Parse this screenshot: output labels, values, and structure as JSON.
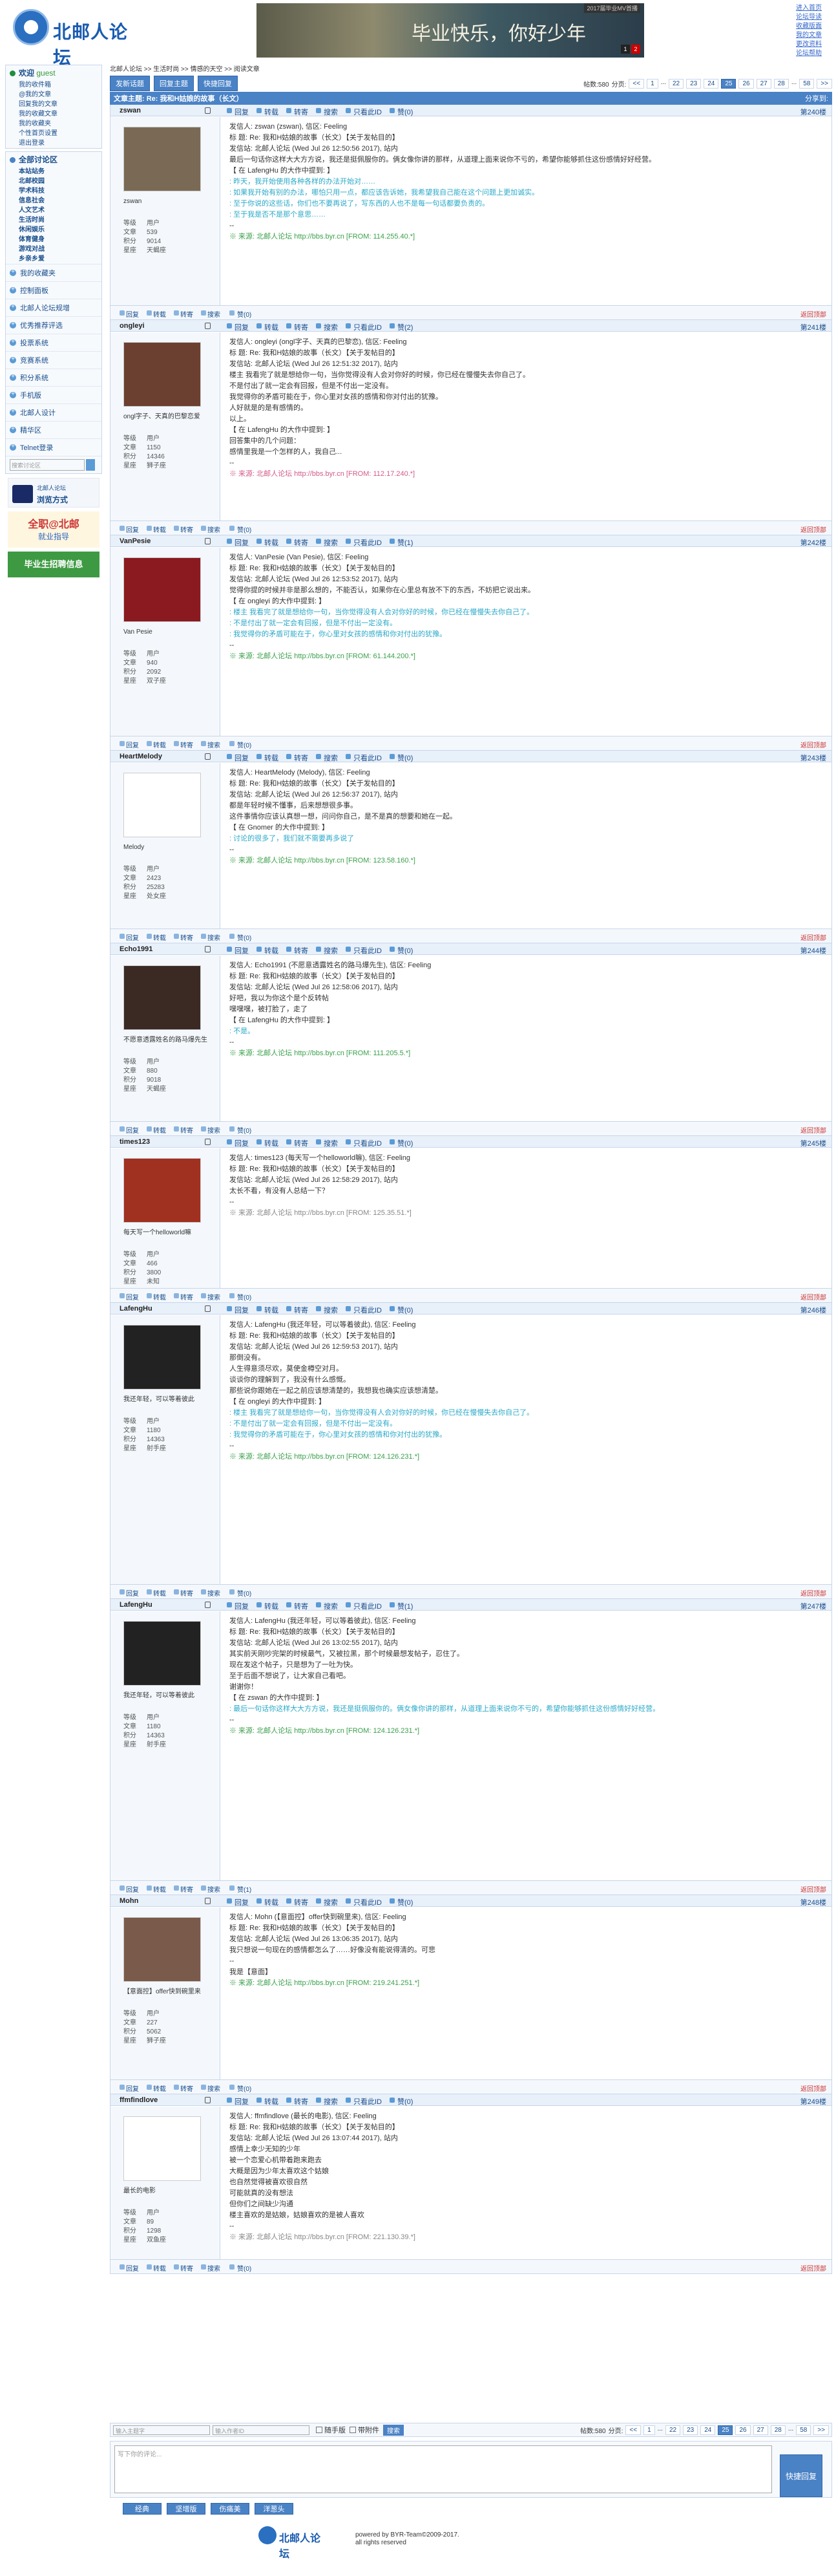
{
  "header": {
    "logo_text": "北邮人论坛",
    "banner_caption": "2017届毕业MV首播",
    "banner_title": "毕业快乐，你好少年",
    "banner_pages": [
      "1",
      "2"
    ],
    "top_links": [
      "进入首页",
      "论坛导读",
      "收藏版面",
      "我的文章",
      "更改资料",
      "论坛帮助"
    ]
  },
  "sidebar": {
    "welcome": "欢迎",
    "guest": "guest",
    "user_links": [
      "我的收件箱",
      "@我的文章",
      "回复我的文章",
      "我的收藏文章",
      "我的收藏夹",
      "个性首页设置",
      "退出登录"
    ],
    "section_title": "全部讨论区",
    "sections": [
      "本站站务",
      "北邮校园",
      "学术科技",
      "信息社会",
      "人文艺术",
      "生活时尚",
      "休闲娱乐",
      "体育健身",
      "游戏对战",
      "乡亲乡爱"
    ],
    "items": [
      "我的收藏夹",
      "控制面板",
      "北邮人论坛规增",
      "优秀推荐评选",
      "投票系统",
      "竞赛系统",
      "积分系统",
      "手机版",
      "北邮人设计",
      "精华区",
      "Telnet登录"
    ],
    "search_placeholder": "搜索讨论区",
    "ads": {
      "a1_title": "北邮人论坛",
      "a1_text": "浏览方式",
      "a2_title": "全职@北邮",
      "a2_text": "就业指导",
      "a3_text": "毕业生招聘信息"
    }
  },
  "main": {
    "breadcrumb": "北邮人论坛 >> 生活时尚 >> 情感的天空 >> 阅读文章",
    "buttons": [
      "发新话题",
      "回复主题",
      "快捷回复"
    ],
    "post_count": "帖数:580",
    "pager_label": "分页:",
    "pages": [
      "<<",
      "1",
      "...",
      "22",
      "23",
      "24",
      "25",
      "26",
      "27",
      "28",
      "...",
      "58",
      ">>"
    ],
    "current_page": "25",
    "topic_prefix": "文章主题:",
    "topic": "Re: 我和H姑娘的故事（长文）",
    "share": "分享到:",
    "post_actions": [
      "回复",
      "转载",
      "转寄",
      "搜索",
      "只看此ID"
    ],
    "foot_actions": [
      "回复",
      "转载",
      "转寄",
      "搜索"
    ],
    "back_top": "返回顶部",
    "labels": {
      "role": "等级",
      "posts": "文章",
      "score": "积分",
      "star": "星座"
    }
  },
  "posts": [
    {
      "uid": "zswan",
      "floor": "第240楼",
      "praise": "赞(0)",
      "up": "赞(0)",
      "nick": "zswan",
      "role": "用户",
      "posts": "539",
      "score": "9014",
      "star": "天蝎座",
      "avatar_color": "#7a6a55",
      "lines": [
        {
          "c": "",
          "t": "发信人: zswan (zswan), 信区: Feeling"
        },
        {
          "c": "",
          "t": "标  题: Re: 我和H姑娘的故事（长文）【关于发帖目的】"
        },
        {
          "c": "",
          "t": "发信站: 北邮人论坛 (Wed Jul 26 12:50:56 2017), 站内"
        },
        {
          "c": "",
          "t": " "
        },
        {
          "c": "",
          "t": "最后一句话你这样大大方方说，我还是挺佩服你的。俩女像你讲的那样，从道理上面来说你不亏的，希望你能够抓住这份感情好好经营。"
        },
        {
          "c": "",
          "t": "【 在 LafengHu 的大作中提到: 】"
        },
        {
          "c": "q",
          "t": ": 昨天，我开始使用各种各样的办法开始对……"
        },
        {
          "c": "q",
          "t": ": 如果我开始有别的办法，哪怕只用一点，都应该告诉她，我希望我自己能在这个问题上更加诚实。"
        },
        {
          "c": "q",
          "t": ": 至于你说的这些话，你们也不要再说了，写东西的人也不是每一句话都要负责的。"
        },
        {
          "c": "q",
          "t": ": 至于我是否不是那个意思……"
        },
        {
          "c": "",
          "t": " "
        },
        {
          "c": "",
          "t": " "
        },
        {
          "c": "",
          "t": "--"
        },
        {
          "c": "",
          "t": " "
        },
        {
          "c": "g",
          "t": "※ 来源: 北邮人论坛 http://bbs.byr.cn [FROM: 114.255.40.*]"
        }
      ]
    },
    {
      "uid": "ongleyi",
      "floor": "第241楼",
      "praise": "赞(2)",
      "up": "赞(0)",
      "nick": "ongl字子、天真的巴黎恋爱",
      "role": "用户",
      "posts": "1150",
      "score": "14346",
      "star": "狮子座",
      "avatar_color": "#6b4030",
      "lines": [
        {
          "c": "",
          "t": "发信人: ongleyi (ongl字子、天真的巴黎恋), 信区: Feeling"
        },
        {
          "c": "",
          "t": "标  题: Re: 我和H姑娘的故事（长文）【关于发帖目的】"
        },
        {
          "c": "",
          "t": "发信站: 北邮人论坛 (Wed Jul 26 12:51:32 2017), 站内"
        },
        {
          "c": "",
          "t": " "
        },
        {
          "c": "",
          "t": "楼主 我看完了就是想给你一句，当你觉得没有人会对你好的时候，你已经在慢慢失去你自己了。"
        },
        {
          "c": "",
          "t": " "
        },
        {
          "c": "",
          "t": "不是付出了就一定会有回报，但是不付出一定没有。"
        },
        {
          "c": "",
          "t": " "
        },
        {
          "c": "",
          "t": "我觉得你的矛盾可能在于，你心里对女孩的感情和你对付出的犹豫。"
        },
        {
          "c": "",
          "t": "人好就是的是有感情的。"
        },
        {
          "c": "",
          "t": "以上。"
        },
        {
          "c": "",
          "t": "【 在 LafengHu 的大作中提到: 】"
        },
        {
          "c": "",
          "t": "回答集中的几个问题："
        },
        {
          "c": "",
          "t": " "
        },
        {
          "c": "",
          "t": "感情里我是一个怎样的人，我自己..."
        },
        {
          "c": "",
          "t": " "
        },
        {
          "c": "",
          "t": "--"
        },
        {
          "c": "",
          "t": " "
        },
        {
          "c": "m",
          "t": "※ 来源: 北邮人论坛 http://bbs.byr.cn [FROM: 112.17.240.*]"
        }
      ]
    },
    {
      "uid": "VanPesie",
      "floor": "第242楼",
      "praise": "赞(1)",
      "up": "赞(0)",
      "nick": "Van Pesie",
      "role": "用户",
      "posts": "940",
      "score": "2092",
      "star": "双子座",
      "avatar_color": "#8a1a20",
      "lines": [
        {
          "c": "",
          "t": "发信人: VanPesie (Van Pesie), 信区: Feeling"
        },
        {
          "c": "",
          "t": "标  题: Re: 我和H姑娘的故事（长文）【关于发帖目的】"
        },
        {
          "c": "",
          "t": "发信站: 北邮人论坛 (Wed Jul 26 12:53:52 2017), 站内"
        },
        {
          "c": "",
          "t": " "
        },
        {
          "c": "",
          "t": "觉得你提的时候并非是那么想的，不能否认，如果你在心里总有放不下的东西，不妨把它说出来。"
        },
        {
          "c": "",
          "t": "【 在 ongleyi 的大作中提到: 】"
        },
        {
          "c": "q",
          "t": ": 楼主 我看完了就是想给你一句，当你觉得没有人会对你好的时候，你已经在慢慢失去你自己了。"
        },
        {
          "c": "q",
          "t": ": 不是付出了就一定会有回报，但是不付出一定没有。"
        },
        {
          "c": "q",
          "t": ": 我觉得你的矛盾可能在于，你心里对女孩的感情和你对付出的犹豫。"
        },
        {
          "c": "",
          "t": " "
        },
        {
          "c": "",
          "t": " "
        },
        {
          "c": "",
          "t": "--"
        },
        {
          "c": "",
          "t": " "
        },
        {
          "c": "g",
          "t": "※ 来源: 北邮人论坛 http://bbs.byr.cn [FROM: 61.144.200.*]"
        }
      ]
    },
    {
      "uid": "HeartMelody",
      "floor": "第243楼",
      "praise": "赞(0)",
      "up": "赞(0)",
      "nick": "Melody",
      "role": "用户",
      "posts": "2423",
      "score": "25283",
      "star": "处女座",
      "avatar_color": "#ffffff",
      "lines": [
        {
          "c": "",
          "t": "发信人: HeartMelody (Melody), 信区: Feeling"
        },
        {
          "c": "",
          "t": "标  题: Re: 我和H姑娘的故事（长文）【关于发帖目的】"
        },
        {
          "c": "",
          "t": "发信站: 北邮人论坛 (Wed Jul 26 12:56:37 2017), 站内"
        },
        {
          "c": "",
          "t": " "
        },
        {
          "c": "",
          "t": "都是年轻时候不懂事，后来想想很多事。"
        },
        {
          "c": "",
          "t": "这件事情你应该认真想一想，问问你自己，是不是真的想要和她在一起。"
        },
        {
          "c": "",
          "t": "【 在 Gnomer 的大作中提到: 】"
        },
        {
          "c": "q",
          "t": ": 讨论的很多了，我们就不需要再多说了"
        },
        {
          "c": "",
          "t": " "
        },
        {
          "c": "",
          "t": "--"
        },
        {
          "c": "",
          "t": " "
        },
        {
          "c": "g",
          "t": "※ 来源: 北邮人论坛 http://bbs.byr.cn [FROM: 123.58.160.*]"
        }
      ]
    },
    {
      "uid": "Echo1991",
      "floor": "第244楼",
      "praise": "赞(0)",
      "up": "赞(0)",
      "nick": "不愿意透露姓名的路马爆先生",
      "role": "用户",
      "posts": "880",
      "score": "9018",
      "star": "天蝎座",
      "avatar_color": "#3b2a24",
      "lines": [
        {
          "c": "",
          "t": "发信人: Echo1991 (不愿意透露姓名的路马爆先生), 信区: Feeling"
        },
        {
          "c": "",
          "t": "标  题: Re: 我和H姑娘的故事（长文）【关于发帖目的】"
        },
        {
          "c": "",
          "t": "发信站: 北邮人论坛 (Wed Jul 26 12:58:06 2017), 站内"
        },
        {
          "c": "",
          "t": " "
        },
        {
          "c": "",
          "t": "好吧，我以为你这个是个反转帖"
        },
        {
          "c": "",
          "t": "嘿嘿嘿，被打脸了，走了"
        },
        {
          "c": "",
          "t": "【 在 LafengHu 的大作中提到: 】"
        },
        {
          "c": "q",
          "t": ": 不是。"
        },
        {
          "c": "",
          "t": " "
        },
        {
          "c": "",
          "t": " "
        },
        {
          "c": "",
          "t": "--"
        },
        {
          "c": "",
          "t": " "
        },
        {
          "c": "g",
          "t": "※ 来源: 北邮人论坛 http://bbs.byr.cn [FROM: 111.205.5.*]"
        }
      ]
    },
    {
      "uid": "times123",
      "floor": "第245楼",
      "praise": "赞(0)",
      "up": "赞(0)",
      "nick": "每天写一个helloworld嘛",
      "role": "用户",
      "posts": "466",
      "score": "3800",
      "star": "未知",
      "avatar_color": "#a03020",
      "lines": [
        {
          "c": "",
          "t": "发信人: times123 (每天写一个helloworld嘛), 信区: Feeling"
        },
        {
          "c": "",
          "t": "标  题: Re: 我和H姑娘的故事（长文）【关于发帖目的】"
        },
        {
          "c": "",
          "t": "发信站: 北邮人论坛 (Wed Jul 26 12:58:29 2017), 站内"
        },
        {
          "c": "",
          "t": " "
        },
        {
          "c": "",
          "t": "太长不看，有没有人总结一下？"
        },
        {
          "c": "",
          "t": " "
        },
        {
          "c": "",
          "t": "--"
        },
        {
          "c": "",
          "t": " "
        },
        {
          "c": "sg",
          "t": "※ 来源: 北邮人论坛 http://bbs.byr.cn [FROM: 125.35.51.*]"
        }
      ]
    },
    {
      "uid": "LafengHu",
      "floor": "第246楼",
      "praise": "赞(0)",
      "up": "赞(0)",
      "nick": "我还年轻，可以等着彼此",
      "role": "用户",
      "posts": "1180",
      "score": "14363",
      "star": "射手座",
      "avatar_color": "#222222",
      "lines": [
        {
          "c": "",
          "t": "发信人: LafengHu (我还年轻，可以等着彼此), 信区: Feeling"
        },
        {
          "c": "",
          "t": "标  题: Re: 我和H姑娘的故事（长文）【关于发帖目的】"
        },
        {
          "c": "",
          "t": "发信站: 北邮人论坛 (Wed Jul 26 12:59:53 2017), 站内"
        },
        {
          "c": "",
          "t": " "
        },
        {
          "c": "",
          "t": "那倒没有。"
        },
        {
          "c": "",
          "t": " "
        },
        {
          "c": "",
          "t": "人生得意须尽欢，莫使金樽空对月。"
        },
        {
          "c": "",
          "t": " "
        },
        {
          "c": "",
          "t": "谈谈你的理解到了，我没有什么感慨。"
        },
        {
          "c": "",
          "t": " "
        },
        {
          "c": "",
          "t": "那些说你跟她在一起之前应该想清楚的，我想我也确实应该想清楚。"
        },
        {
          "c": "",
          "t": " "
        },
        {
          "c": "",
          "t": "【 在 ongleyi 的大作中提到: 】"
        },
        {
          "c": "q",
          "t": ": 楼主 我看完了就是想给你一句，当你觉得没有人会对你好的时候，你已经在慢慢失去你自己了。"
        },
        {
          "c": "q",
          "t": ": 不是付出了就一定会有回报，但是不付出一定没有。"
        },
        {
          "c": "q",
          "t": ": 我觉得你的矛盾可能在于，你心里对女孩的感情和你对付出的犹豫。"
        },
        {
          "c": "",
          "t": " "
        },
        {
          "c": "",
          "t": "--"
        },
        {
          "c": "",
          "t": " "
        },
        {
          "c": "g",
          "t": "※ 来源: 北邮人论坛 http://bbs.byr.cn [FROM: 124.126.231.*]"
        }
      ]
    },
    {
      "uid": "LafengHu",
      "floor": "第247楼",
      "praise": "赞(1)",
      "up": "赞(1)",
      "nick": "我还年轻，可以等着彼此",
      "role": "用户",
      "posts": "1180",
      "score": "14363",
      "star": "射手座",
      "avatar_color": "#222222",
      "lines": [
        {
          "c": "",
          "t": "发信人: LafengHu (我还年轻，可以等着彼此), 信区: Feeling"
        },
        {
          "c": "",
          "t": "标  题: Re: 我和H姑娘的故事（长文）【关于发帖目的】"
        },
        {
          "c": "",
          "t": "发信站: 北邮人论坛 (Wed Jul 26 13:02:55 2017), 站内"
        },
        {
          "c": "",
          "t": " "
        },
        {
          "c": "",
          "t": "其实前天刚吵完架的时候最气，又被拉黑，那个时候最想发帖子，忍住了。"
        },
        {
          "c": "",
          "t": " "
        },
        {
          "c": "",
          "t": "现在发这个帖子，只是想为了一吐为快。"
        },
        {
          "c": "",
          "t": " "
        },
        {
          "c": "",
          "t": "至于后面不想说了，让大家自己看吧。"
        },
        {
          "c": "",
          "t": " "
        },
        {
          "c": "",
          "t": "谢谢你！"
        },
        {
          "c": "",
          "t": " "
        },
        {
          "c": "",
          "t": "【 在 zswan 的大作中提到: 】"
        },
        {
          "c": "q",
          "t": ": 最后一句话你这样大大方方说，我还是挺佩服你的。俩女像你讲的那样，从道理上面来说你不亏的，希望你能够抓住这份感情好好经营。"
        },
        {
          "c": "",
          "t": " "
        },
        {
          "c": "",
          "t": "--"
        },
        {
          "c": "",
          "t": " "
        },
        {
          "c": "g",
          "t": "※ 来源: 北邮人论坛 http://bbs.byr.cn [FROM: 124.126.231.*]"
        }
      ]
    },
    {
      "uid": "Mohn",
      "floor": "第248楼",
      "praise": "赞(0)",
      "up": "赞(0)",
      "nick": "【意面控】offer快到碗里来",
      "role": "用户",
      "posts": "227",
      "score": "5062",
      "star": "狮子座",
      "avatar_color": "#7a5a4a",
      "lines": [
        {
          "c": "",
          "t": "发信人: Mohn (【意面控】offer快到碗里来), 信区: Feeling"
        },
        {
          "c": "",
          "t": "标  题: Re: 我和H姑娘的故事（长文）【关于发帖目的】"
        },
        {
          "c": "",
          "t": "发信站: 北邮人论坛 (Wed Jul 26 13:06:35 2017), 站内"
        },
        {
          "c": "",
          "t": " "
        },
        {
          "c": "",
          "t": "我只想说一句现在的感情都怎么了……好像没有能说得清的。可悲"
        },
        {
          "c": "",
          "t": " "
        },
        {
          "c": "",
          "t": "--"
        },
        {
          "c": "",
          "t": "我是【意面】"
        },
        {
          "c": "",
          "t": " "
        },
        {
          "c": "g",
          "t": "※ 来源: 北邮人论坛 http://bbs.byr.cn [FROM: 219.241.251.*]"
        }
      ]
    },
    {
      "uid": "ffmfindlove",
      "floor": "第249楼",
      "praise": "赞(0)",
      "up": "赞(0)",
      "nick": "最长的电影",
      "role": "用户",
      "posts": "89",
      "score": "1298",
      "star": "双鱼座",
      "avatar_color": "#ffffff",
      "lines": [
        {
          "c": "",
          "t": "发信人: ffmfindlove (最长的电影), 信区: Feeling"
        },
        {
          "c": "",
          "t": "标  题: Re: 我和H姑娘的故事（长文）【关于发帖目的】"
        },
        {
          "c": "",
          "t": "发信站: 北邮人论坛 (Wed Jul 26 13:07:44 2017), 站内"
        },
        {
          "c": "",
          "t": " "
        },
        {
          "c": "",
          "t": "感情上幸少无知的少年"
        },
        {
          "c": "",
          "t": "被一个恋爱心机带着跑来跑去"
        },
        {
          "c": "",
          "t": " "
        },
        {
          "c": "",
          "t": "大概是因为少年太喜欢这个姑娘"
        },
        {
          "c": "",
          "t": "也自然觉得被喜欢很自然"
        },
        {
          "c": "",
          "t": "可能就真的没有想法"
        },
        {
          "c": "",
          "t": " "
        },
        {
          "c": "",
          "t": "但你们之间缺少沟通"
        },
        {
          "c": "",
          "t": "楼主喜欢的是姑娘，姑娘喜欢的是被人喜欢"
        },
        {
          "c": "",
          "t": " "
        },
        {
          "c": "",
          "t": "--"
        },
        {
          "c": "",
          "t": " "
        },
        {
          "c": "sg",
          "t": "※ 来源: 北邮人论坛 http://bbs.byr.cn [FROM: 221.130.39.*]"
        }
      ]
    }
  ],
  "bottom": {
    "input1_placeholder": "输入主题字",
    "input2_placeholder": "输入作者ID",
    "check1": "随手版",
    "check2": "带附件",
    "search_btn": "搜索",
    "reply_placeholder": "写下你的评论...",
    "reply_btn": "快捷回复",
    "tabs": [
      "经典",
      "坚增版",
      "伤痛美",
      "洋葱头"
    ]
  },
  "footer": {
    "logo_text": "北邮人论坛",
    "line1": "powered by BYR-Team©2009-2017.",
    "line2": "all rights reserved"
  }
}
